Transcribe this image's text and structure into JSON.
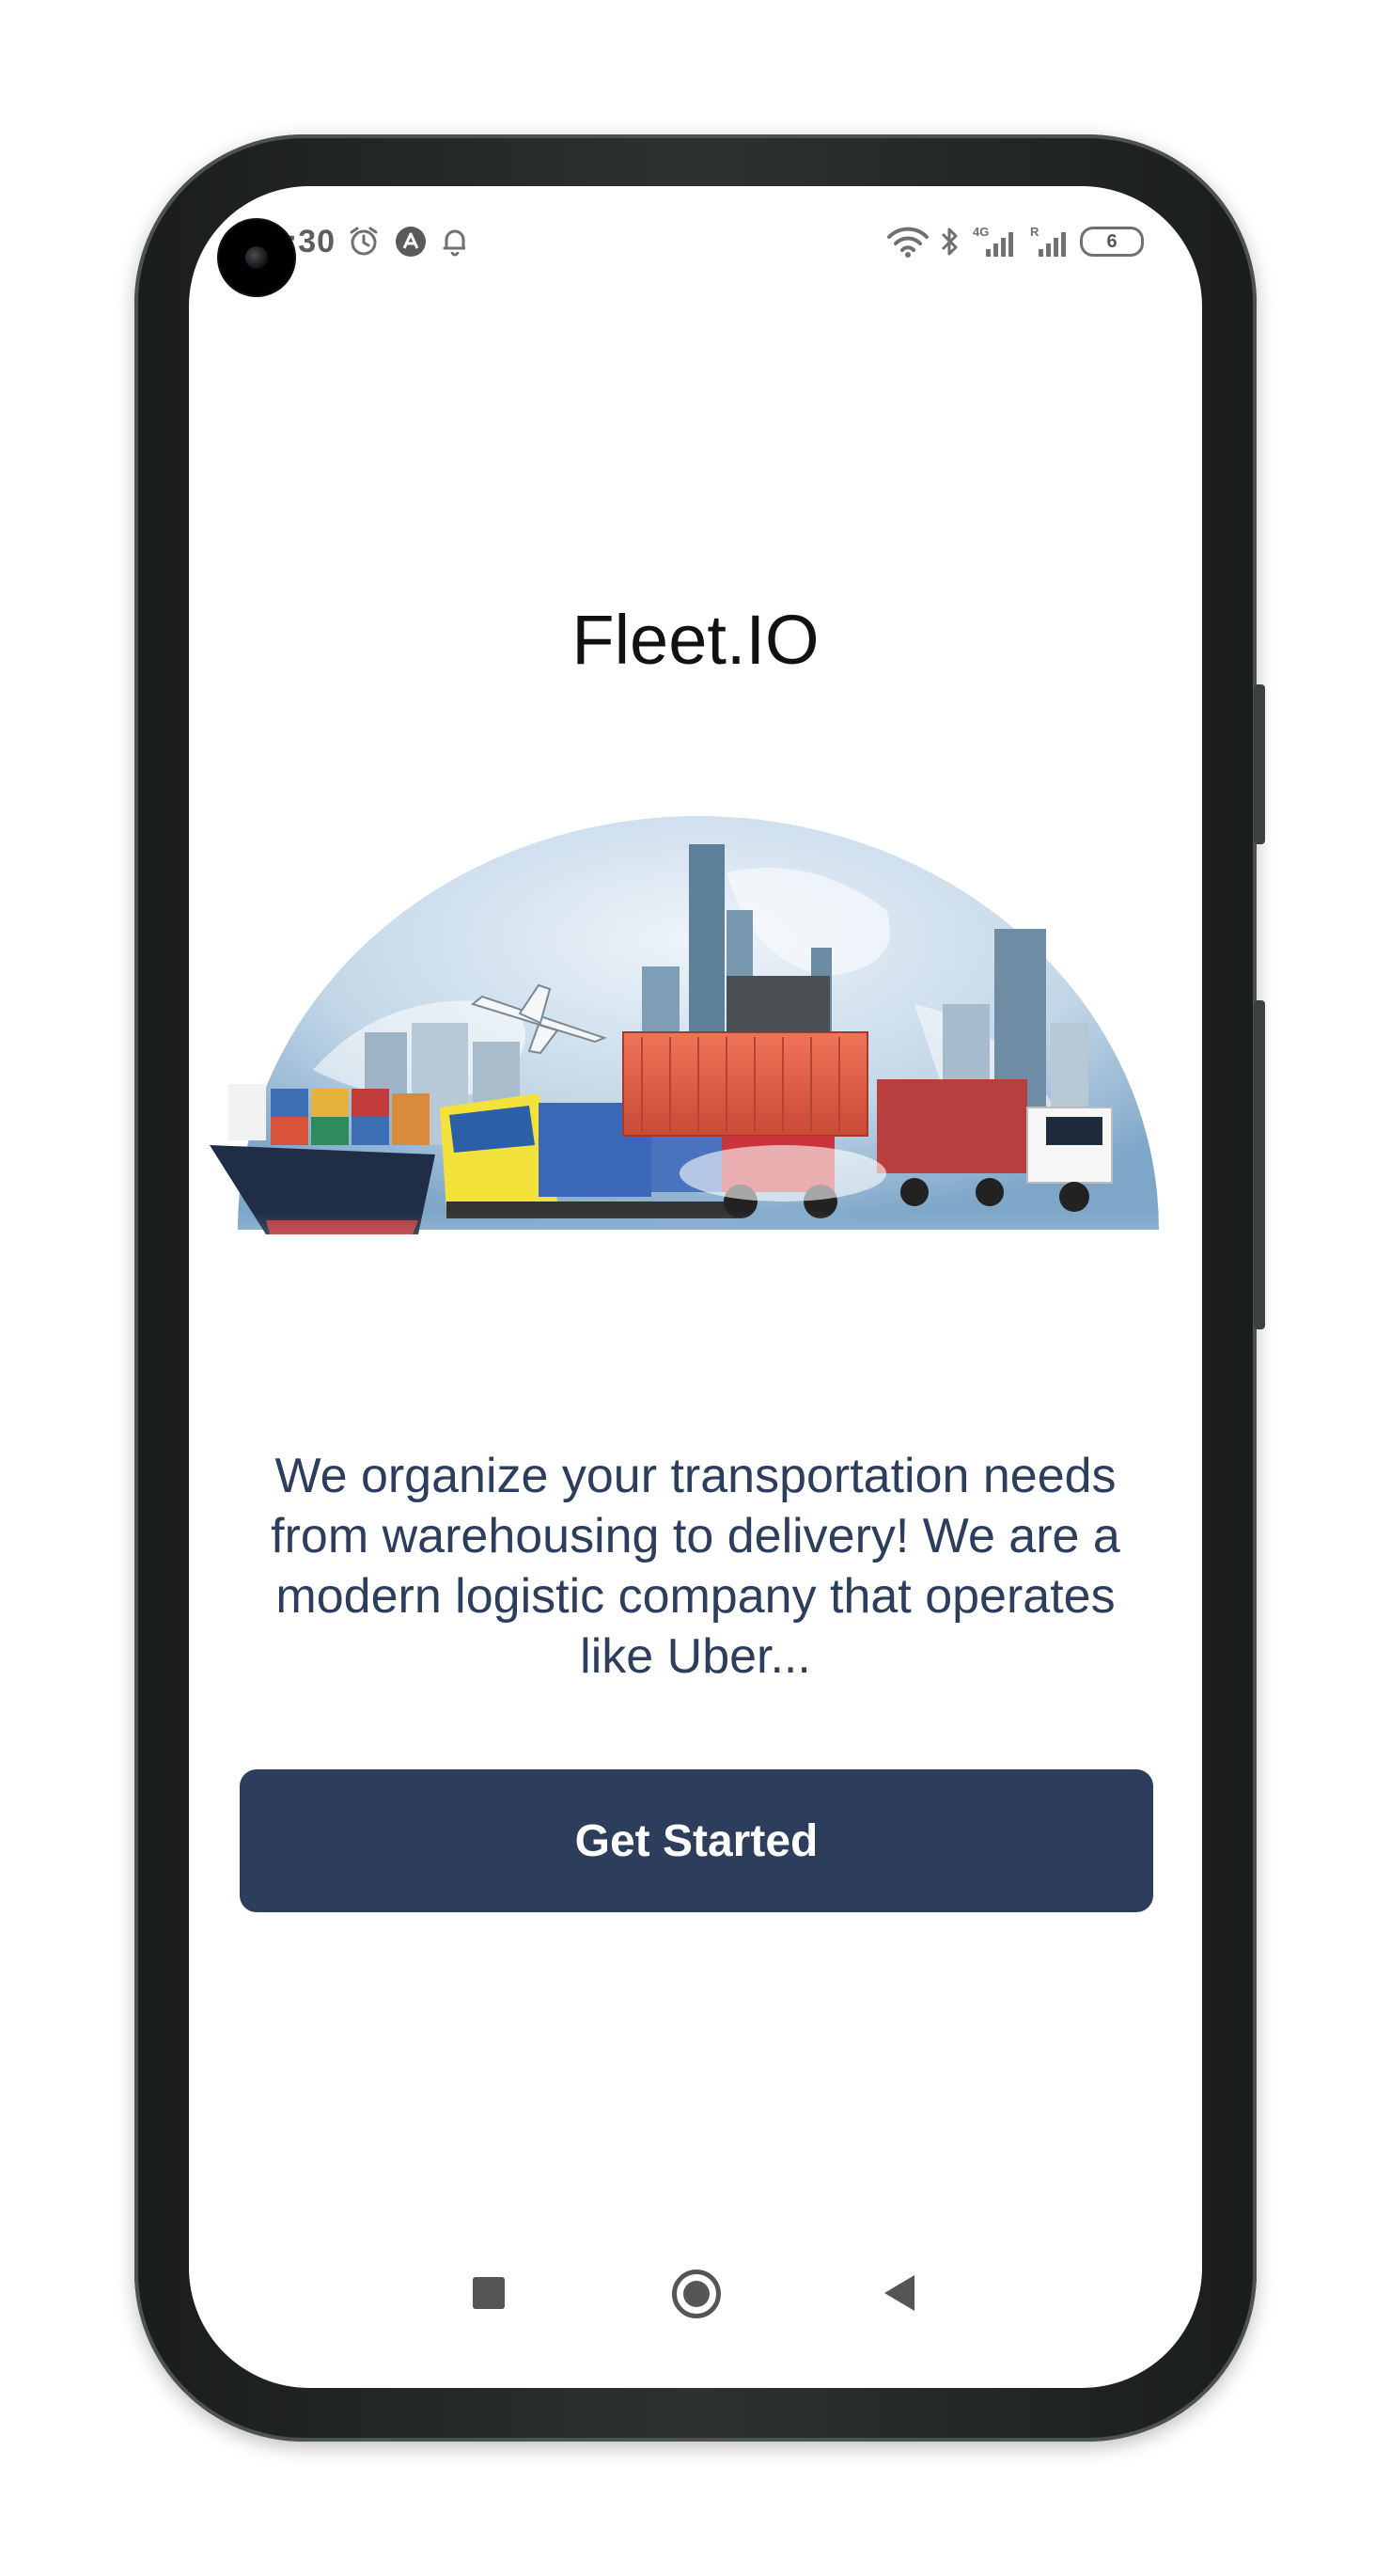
{
  "status_bar": {
    "time": "5:30",
    "left_icons": [
      "alarm-icon",
      "app-notification-icon",
      "bell-icon"
    ],
    "right_icons": [
      "wifi-icon",
      "bluetooth-icon",
      "signal-4g-icon",
      "signal-roaming-icon",
      "battery-icon"
    ],
    "network_label": "4G",
    "roaming_label": "R",
    "battery_level": "6"
  },
  "app": {
    "title": "Fleet.IO",
    "hero_image_alt": "hero-logistics-image",
    "tagline": "We organize your transportation needs from warehousing to delivery! We are a modern logistic company that operates like Uber...",
    "cta_label": "Get Started"
  },
  "nav_bar": {
    "items": [
      "recents-icon",
      "home-icon",
      "back-icon"
    ]
  },
  "colors": {
    "primary": "#2c3e5c",
    "title_text": "#111111",
    "background": "#ffffff"
  }
}
